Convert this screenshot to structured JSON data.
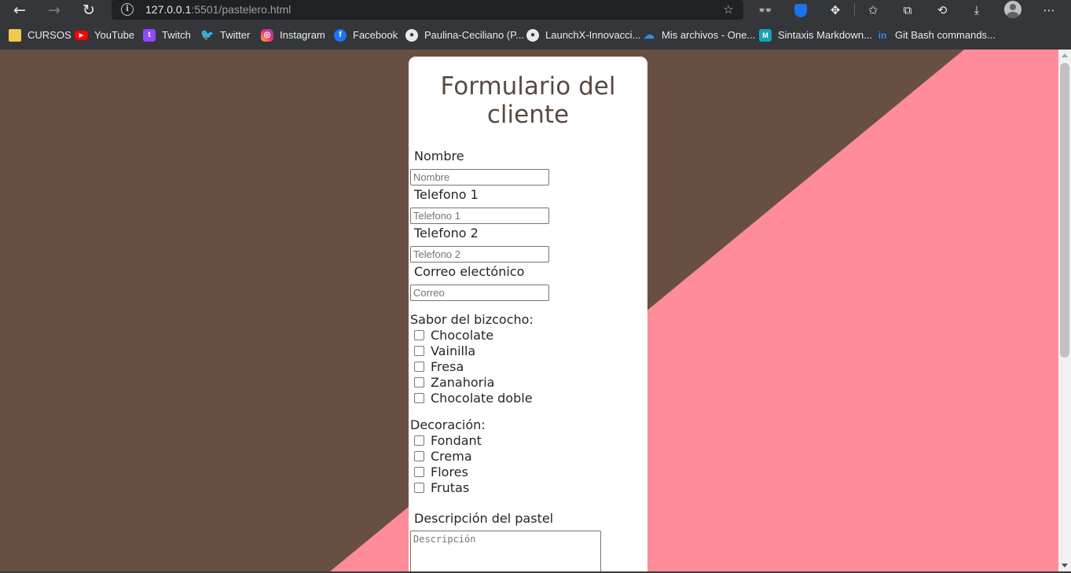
{
  "browser": {
    "url_host": "127.0.0.1",
    "url_rest": ":5501/pastelero.html",
    "bookmarks": [
      {
        "label": "CURSOS",
        "icon": "folder-icon"
      },
      {
        "label": "YouTube",
        "icon": "youtube-icon"
      },
      {
        "label": "Twitch",
        "icon": "twitch-icon"
      },
      {
        "label": "Twitter",
        "icon": "twitter-icon"
      },
      {
        "label": "Instagram",
        "icon": "instagram-icon"
      },
      {
        "label": "Facebook",
        "icon": "facebook-icon"
      },
      {
        "label": "Paulina-Ceciliano (P...",
        "icon": "github-icon"
      },
      {
        "label": "LaunchX-Innovacci...",
        "icon": "github-icon"
      },
      {
        "label": "Mis archivos - One...",
        "icon": "onedrive-icon"
      },
      {
        "label": "Sintaxis Markdown...",
        "icon": "markdown-icon"
      },
      {
        "label": "Git Bash commands...",
        "icon": "linkedin-icon"
      }
    ]
  },
  "page": {
    "background_color": "#684f43",
    "accent_color": "#ff8c98",
    "form": {
      "title": "Formulario del cliente",
      "fields": [
        {
          "label": "Nombre",
          "placeholder": "Nombre"
        },
        {
          "label": "Telefono 1",
          "placeholder": "Telefono 1"
        },
        {
          "label": "Telefono 2",
          "placeholder": "Telefono 2"
        },
        {
          "label": "Correo electónico",
          "placeholder": "Correo"
        }
      ],
      "flavor_section": {
        "label": "Sabor del bizcocho:",
        "options": [
          "Chocolate",
          "Vainilla",
          "Fresa",
          "Zanahoria",
          "Chocolate doble"
        ]
      },
      "decoration_section": {
        "label": "Decoración:",
        "options": [
          "Fondant",
          "Crema",
          "Flores",
          "Frutas"
        ]
      },
      "description": {
        "label": "Descripción del pastel",
        "placeholder": "Descripción"
      }
    }
  }
}
